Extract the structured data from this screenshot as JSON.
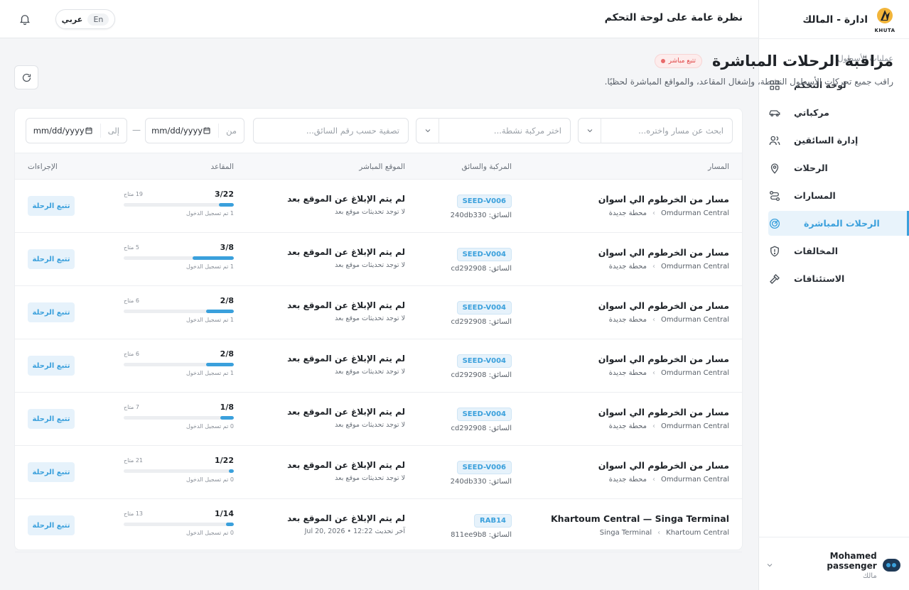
{
  "brand": {
    "name": "ادارة - المالك",
    "logo_text": "KHUTA"
  },
  "topbar": {
    "heading": "نظرة عامة على لوحة التحكم",
    "lang_ar": "عربي",
    "lang_en": "En"
  },
  "sidebar": {
    "section_label": "عمليات الأسطول",
    "items": [
      {
        "label": "لوحة التحكم",
        "icon": "dashboard-icon",
        "active": false
      },
      {
        "label": "مركباتي",
        "icon": "car-icon",
        "active": false
      },
      {
        "label": "إدارة السائقين",
        "icon": "users-icon",
        "active": false
      },
      {
        "label": "الرحلات",
        "icon": "location-pin-icon",
        "active": false
      },
      {
        "label": "المسارات",
        "icon": "route-icon",
        "active": false
      },
      {
        "label": "الرحلات المباشرة",
        "icon": "radar-icon",
        "active": true
      },
      {
        "label": "المخالفات",
        "icon": "shield-alert-icon",
        "active": false
      },
      {
        "label": "الاستئنافات",
        "icon": "gavel-icon",
        "active": false
      }
    ]
  },
  "user": {
    "name": "Mohamed passenger",
    "role": "مالك"
  },
  "main": {
    "title": "مراقبة الرحلات المباشرة",
    "live_badge": "تتبع مباشر",
    "subtitle": "راقب جميع تحركات الأسطول النشطة، وإشغال المقاعد، والمواقع المباشرة لحظيًا."
  },
  "filters": {
    "route_placeholder": "ابحث عن مسار واختره...",
    "vehicle_placeholder": "اختر مركبة نشطة...",
    "driver_placeholder": "تصفية حسب رقم السائق...",
    "from_label": "من",
    "from_value": "mm/dd/yyyy",
    "to_label": "إلى",
    "to_value": "mm/dd/yyyy",
    "dash": "—"
  },
  "table": {
    "headers": {
      "route": "المسار",
      "vehicle": "المركبة والسائق",
      "location": "الموقع المباشر",
      "seats": "المقاعد",
      "actions": "الإجراءات"
    },
    "rows": [
      {
        "route": "مسار من الخرطوم الي اسوان",
        "from": "Omdurman Central",
        "to": "محطة جديدة",
        "plate": "SEED-V006",
        "driver": "السائق: 240db330",
        "loc_title": "لم يتم الإبلاغ عن الموقع بعد",
        "loc_sub": "لا توجد تحديثات موقع بعد",
        "seats": "3/22",
        "available": "19 متاح",
        "checked_in": "1 تم تسجيل الدخول",
        "fill": 0.136,
        "action": "تتبع الرحلة"
      },
      {
        "route": "مسار من الخرطوم الي اسوان",
        "from": "Omdurman Central",
        "to": "محطة جديدة",
        "plate": "SEED-V004",
        "driver": "السائق: cd292908",
        "loc_title": "لم يتم الإبلاغ عن الموقع بعد",
        "loc_sub": "لا توجد تحديثات موقع بعد",
        "seats": "3/8",
        "available": "5 متاح",
        "checked_in": "1 تم تسجيل الدخول",
        "fill": 0.375,
        "action": "تتبع الرحلة"
      },
      {
        "route": "مسار من الخرطوم الي اسوان",
        "from": "Omdurman Central",
        "to": "محطة جديدة",
        "plate": "SEED-V004",
        "driver": "السائق: cd292908",
        "loc_title": "لم يتم الإبلاغ عن الموقع بعد",
        "loc_sub": "لا توجد تحديثات موقع بعد",
        "seats": "2/8",
        "available": "6 متاح",
        "checked_in": "1 تم تسجيل الدخول",
        "fill": 0.25,
        "action": "تتبع الرحلة"
      },
      {
        "route": "مسار من الخرطوم الي اسوان",
        "from": "Omdurman Central",
        "to": "محطة جديدة",
        "plate": "SEED-V004",
        "driver": "السائق: cd292908",
        "loc_title": "لم يتم الإبلاغ عن الموقع بعد",
        "loc_sub": "لا توجد تحديثات موقع بعد",
        "seats": "2/8",
        "available": "6 متاح",
        "checked_in": "1 تم تسجيل الدخول",
        "fill": 0.25,
        "action": "تتبع الرحلة"
      },
      {
        "route": "مسار من الخرطوم الي اسوان",
        "from": "Omdurman Central",
        "to": "محطة جديدة",
        "plate": "SEED-V004",
        "driver": "السائق: cd292908",
        "loc_title": "لم يتم الإبلاغ عن الموقع بعد",
        "loc_sub": "لا توجد تحديثات موقع بعد",
        "seats": "1/8",
        "available": "7 متاح",
        "checked_in": "0 تم تسجيل الدخول",
        "fill": 0.125,
        "action": "تتبع الرحلة"
      },
      {
        "route": "مسار من الخرطوم الي اسوان",
        "from": "Omdurman Central",
        "to": "محطة جديدة",
        "plate": "SEED-V006",
        "driver": "السائق: 240db330",
        "loc_title": "لم يتم الإبلاغ عن الموقع بعد",
        "loc_sub": "لا توجد تحديثات موقع بعد",
        "seats": "1/22",
        "available": "21 متاح",
        "checked_in": "0 تم تسجيل الدخول",
        "fill": 0.045,
        "action": "تتبع الرحلة"
      },
      {
        "route": "Khartoum Central — Singa Terminal",
        "from": "Khartoum Central",
        "to": "Singa Terminal",
        "plate": "RAB14",
        "driver": "السائق: 811ee9b8",
        "loc_title": "لم يتم الإبلاغ عن الموقع بعد",
        "loc_sub": "آخر تحديث 12:22 • Jul 20, 2026",
        "seats": "1/14",
        "available": "13 متاح",
        "checked_in": "0 تم تسجيل الدخول",
        "fill": 0.071,
        "action": "تتبع الرحلة"
      }
    ]
  },
  "colors": {
    "accent": "#3aa0dc",
    "live": "#e04848"
  }
}
